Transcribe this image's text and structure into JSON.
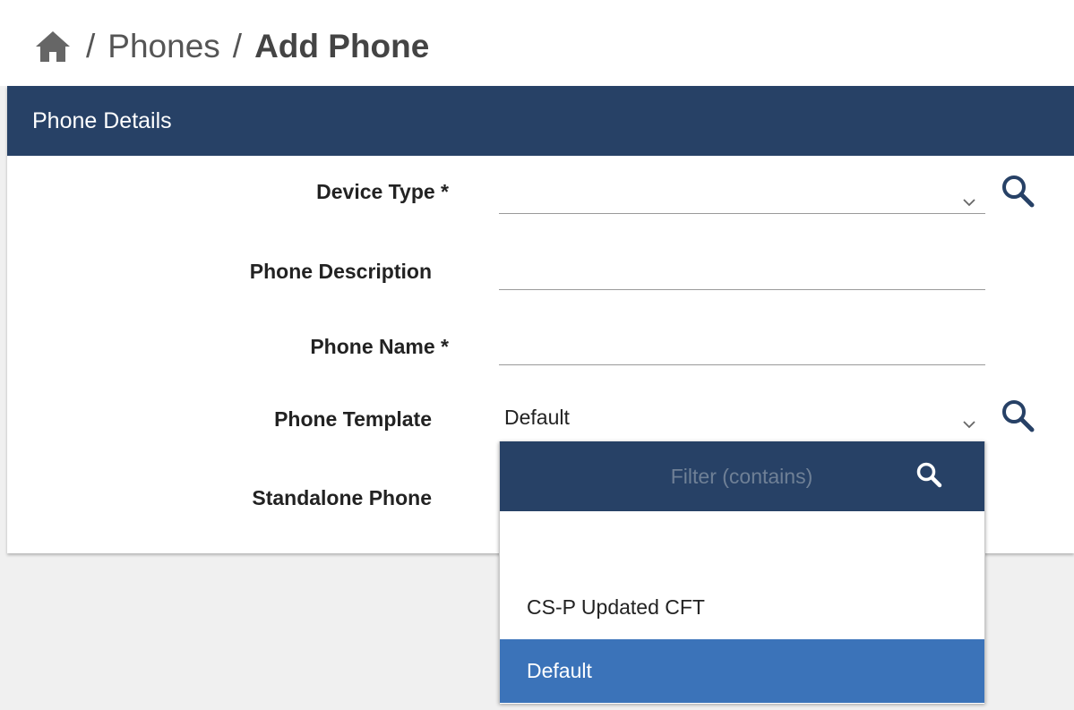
{
  "breadcrumb": {
    "home_icon": "home-icon",
    "separator": "/",
    "items": [
      "Phones",
      "Add Phone"
    ]
  },
  "section": {
    "title": "Phone Details"
  },
  "form": {
    "device_type_label": "Device Type *",
    "device_type_value": "",
    "phone_description_label": "Phone Description",
    "phone_description_value": "",
    "phone_name_label": "Phone Name *",
    "phone_name_value": "",
    "phone_template_label": "Phone Template",
    "phone_template_value": "Default",
    "standalone_phone_label": "Standalone Phone"
  },
  "dropdown": {
    "filter_placeholder": "Filter (contains)",
    "options": [
      "",
      "CS-P Updated CFT",
      "Default"
    ],
    "selected": "Default"
  },
  "colors": {
    "header_bg": "#274166",
    "selected_bg": "#3b73b9",
    "page_bg": "#f0f0f0"
  },
  "icons": {
    "search": "search-icon",
    "chevron": "chevron-down-icon",
    "home": "home-icon"
  }
}
